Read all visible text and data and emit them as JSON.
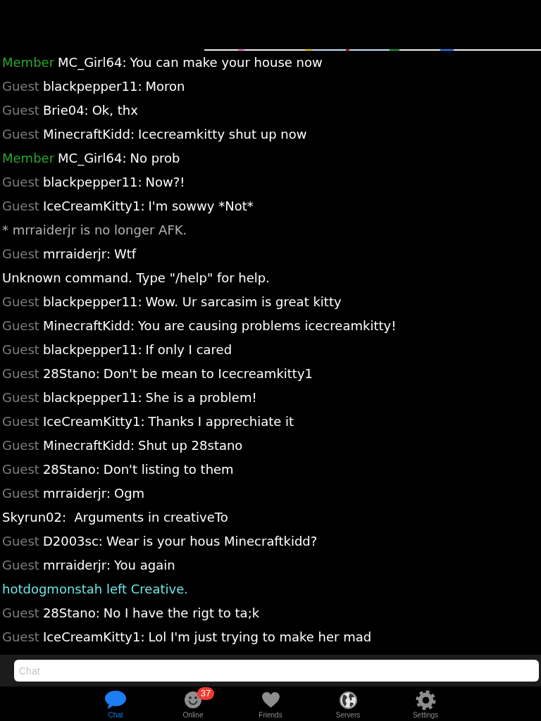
{
  "messages": [
    {
      "kind": "chat",
      "rank": "Member",
      "color": "#2aa82a",
      "name": "MC_Girl64:",
      "text": "You can make your house now"
    },
    {
      "kind": "chat",
      "rank": "Guest",
      "color": "#7d7d7d",
      "name": "blackpepper11:",
      "text": "Moron"
    },
    {
      "kind": "chat",
      "rank": "Guest",
      "color": "#7d7d7d",
      "name": "Brie04:",
      "text": "Ok, thx"
    },
    {
      "kind": "chat",
      "rank": "Guest",
      "color": "#7d7d7d",
      "name": "MinecraftKidd:",
      "text": "Icecreamkitty shut up now"
    },
    {
      "kind": "chat",
      "rank": "Member",
      "color": "#2aa82a",
      "name": "MC_Girl64:",
      "text": "No prob"
    },
    {
      "kind": "chat",
      "rank": "Guest",
      "color": "#7d7d7d",
      "name": "blackpepper11:",
      "text": "Now?!"
    },
    {
      "kind": "chat",
      "rank": "Guest",
      "color": "#7d7d7d",
      "name": "IceCreamKitty1:",
      "text": "I'm sowwy *Not*"
    },
    {
      "kind": "notice",
      "text": "* mrraiderjr is no longer AFK."
    },
    {
      "kind": "chat",
      "rank": "Guest",
      "color": "#7d7d7d",
      "name": "mrraiderjr:",
      "text": "Wtf"
    },
    {
      "kind": "plain",
      "text": "Unknown command. Type \"/help\" for help."
    },
    {
      "kind": "chat",
      "rank": "Guest",
      "color": "#7d7d7d",
      "name": "blackpepper11:",
      "text": "Wow. Ur sarcasim is great kitty"
    },
    {
      "kind": "chat",
      "rank": "Guest",
      "color": "#7d7d7d",
      "name": "MinecraftKidd:",
      "text": "You are causing problems icecreamkitty!"
    },
    {
      "kind": "chat",
      "rank": "Guest",
      "color": "#7d7d7d",
      "name": "blackpepper11:",
      "text": "If only I cared"
    },
    {
      "kind": "chat",
      "rank": "Guest",
      "color": "#7d7d7d",
      "name": "28Stano:",
      "text": "Don't be mean to Icecreamkitty1"
    },
    {
      "kind": "chat",
      "rank": "Guest",
      "color": "#7d7d7d",
      "name": "blackpepper11:",
      "text": "She is a problem!"
    },
    {
      "kind": "chat",
      "rank": "Guest",
      "color": "#7d7d7d",
      "name": "IceCreamKitty1:",
      "text": "Thanks I apprechiate it"
    },
    {
      "kind": "chat",
      "rank": "Guest",
      "color": "#7d7d7d",
      "name": "MinecraftKidd:",
      "text": "Shut up 28stano"
    },
    {
      "kind": "chat",
      "rank": "Guest",
      "color": "#7d7d7d",
      "name": "28Stano:",
      "text": "Don't listing to them"
    },
    {
      "kind": "chat",
      "rank": "Guest",
      "color": "#7d7d7d",
      "name": "mrraiderjr:",
      "text": "Ogm"
    },
    {
      "kind": "plain",
      "text": "Skyrun02:  Arguments in creativeTo"
    },
    {
      "kind": "chat",
      "rank": "Guest",
      "color": "#7d7d7d",
      "name": "D2003sc:",
      "text": "Wear is your hous Minecraftkidd?"
    },
    {
      "kind": "chat",
      "rank": "Guest",
      "color": "#7d7d7d",
      "name": "mrraiderjr:",
      "text": "You again"
    },
    {
      "kind": "event",
      "text": "hotdogmonstah left Creative."
    },
    {
      "kind": "chat",
      "rank": "Guest",
      "color": "#7d7d7d",
      "name": "28Stano:",
      "text": "No I have the rigt to ta;k"
    },
    {
      "kind": "chat",
      "rank": "Guest",
      "color": "#7d7d7d",
      "name": "IceCreamKitty1:",
      "text": "Lol I'm just trying to make her mad"
    }
  ],
  "input": {
    "placeholder": "Chat"
  },
  "tabs": [
    {
      "label": "Chat",
      "selected": true
    },
    {
      "label": "Online",
      "selected": false,
      "badge": "37"
    },
    {
      "label": "Friends",
      "selected": false
    },
    {
      "label": "Servers",
      "selected": false
    },
    {
      "label": "Settings",
      "selected": false
    }
  ]
}
